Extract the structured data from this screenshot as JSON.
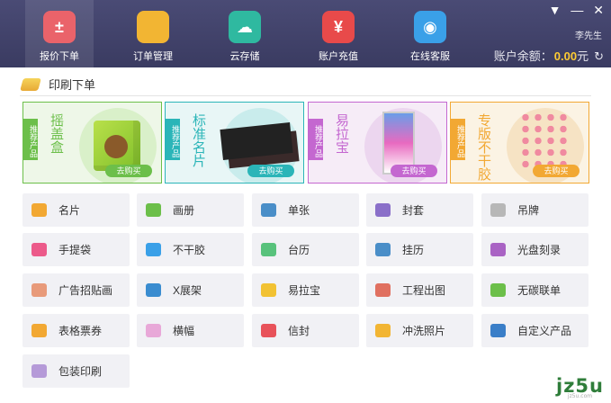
{
  "nav": [
    {
      "label": "报价下单",
      "icon": "calculator-icon",
      "color": "#e8525a",
      "active": true,
      "glyph": "±"
    },
    {
      "label": "订单管理",
      "icon": "folder-icon",
      "color": "#f2b533",
      "active": false,
      "glyph": ""
    },
    {
      "label": "云存储",
      "icon": "cloud-icon",
      "color": "#2fb9a0",
      "active": false,
      "glyph": "☁"
    },
    {
      "label": "账户充值",
      "icon": "wallet-yen-icon",
      "color": "#e84a4a",
      "active": false,
      "glyph": "¥"
    },
    {
      "label": "在线客服",
      "icon": "qq-icon",
      "color": "#3aa0e8",
      "active": false,
      "glyph": "◉"
    }
  ],
  "window": {
    "menu_glyph": "▼",
    "min_glyph": "—",
    "close_glyph": "✕"
  },
  "user": {
    "name": "李先生"
  },
  "balance": {
    "label": "账户余额：",
    "value": "0.00",
    "unit": "元",
    "refresh_glyph": "↻"
  },
  "section": {
    "title": "印刷下单"
  },
  "promos": [
    {
      "tag": "推荐产品",
      "title": "摇盖盒",
      "buy": "去购买",
      "accent": "#6cbf4a",
      "bg": "#eef7e8",
      "circle": "#d9f0c9",
      "icon": "gift-box-image"
    },
    {
      "tag": "推荐产品",
      "title": "标准名片",
      "buy": "去购买",
      "accent": "#2bb5b8",
      "bg": "#e8f6f6",
      "circle": "#c9ecec",
      "icon": "business-card-image"
    },
    {
      "tag": "推荐产品",
      "title": "易拉宝",
      "buy": "去购买",
      "accent": "#c467d0",
      "bg": "#f6ecf7",
      "circle": "#ecd6ef",
      "icon": "rollup-banner-image"
    },
    {
      "tag": "推荐产品",
      "title": "专版不干胶",
      "buy": "去购买",
      "accent": "#f2a833",
      "bg": "#fbf3e4",
      "circle": "#f6e3c4",
      "icon": "sticker-sheet-image"
    }
  ],
  "products": [
    {
      "label": "名片",
      "icon": "card-icon",
      "color": "#f2a833"
    },
    {
      "label": "画册",
      "icon": "album-icon",
      "color": "#6cbf4a"
    },
    {
      "label": "单张",
      "icon": "document-icon",
      "color": "#4a8ec8"
    },
    {
      "label": "封套",
      "icon": "envelope-icon",
      "color": "#8a6fc9"
    },
    {
      "label": "吊牌",
      "icon": "tag-icon",
      "color": "#b7b7b7"
    },
    {
      "label": "手提袋",
      "icon": "bag-icon",
      "color": "#ec5a8a"
    },
    {
      "label": "不干胶",
      "icon": "sticker-icon",
      "color": "#3aa0e8"
    },
    {
      "label": "台历",
      "icon": "desk-calendar-icon",
      "color": "#58c27c"
    },
    {
      "label": "挂历",
      "icon": "wall-calendar-icon",
      "color": "#4a8ec8"
    },
    {
      "label": "光盘刻录",
      "icon": "disc-icon",
      "color": "#a963c4"
    },
    {
      "label": "广告招贴画",
      "icon": "poster-icon",
      "color": "#e89a7a"
    },
    {
      "label": "X展架",
      "icon": "x-stand-icon",
      "color": "#3a8cd0"
    },
    {
      "label": "易拉宝",
      "icon": "rollup-icon",
      "color": "#f2c233"
    },
    {
      "label": "工程出图",
      "icon": "blueprint-icon",
      "color": "#e07060"
    },
    {
      "label": "无碳联单",
      "icon": "carbonless-form-icon",
      "color": "#6cbf4a"
    },
    {
      "label": "表格票券",
      "icon": "ticket-icon",
      "color": "#f2a833"
    },
    {
      "label": "横幅",
      "icon": "banner-icon",
      "color": "#e8a8d8"
    },
    {
      "label": "信封",
      "icon": "mail-icon",
      "color": "#e8525a"
    },
    {
      "label": "冲洗照片",
      "icon": "photo-icon",
      "color": "#f2b533"
    },
    {
      "label": "自定义产品",
      "icon": "mouse-icon",
      "color": "#3a7ec8"
    },
    {
      "label": "包装印刷",
      "icon": "package-icon",
      "color": "#b59ad8"
    }
  ],
  "watermark": {
    "text": "jz5u",
    "sub": "jz5u.com"
  }
}
